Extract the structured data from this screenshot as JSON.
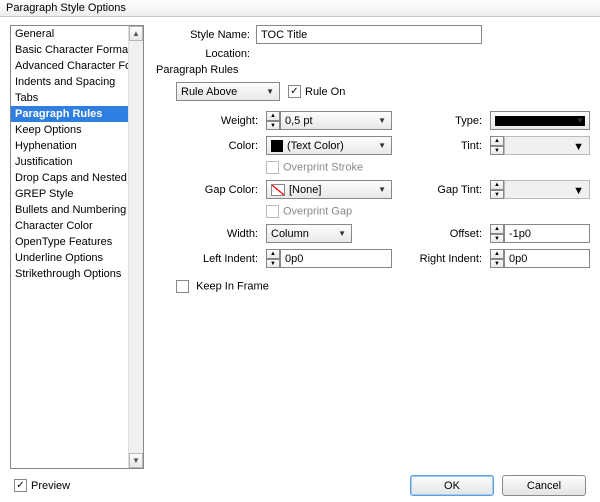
{
  "window": {
    "title": "Paragraph Style Options"
  },
  "sidebar": {
    "items": [
      {
        "label": "General"
      },
      {
        "label": "Basic Character Formats"
      },
      {
        "label": "Advanced Character Formats"
      },
      {
        "label": "Indents and Spacing"
      },
      {
        "label": "Tabs"
      },
      {
        "label": "Paragraph Rules"
      },
      {
        "label": "Keep Options"
      },
      {
        "label": "Hyphenation"
      },
      {
        "label": "Justification"
      },
      {
        "label": "Drop Caps and Nested Styles"
      },
      {
        "label": "GREP Style"
      },
      {
        "label": "Bullets and Numbering"
      },
      {
        "label": "Character Color"
      },
      {
        "label": "OpenType Features"
      },
      {
        "label": "Underline Options"
      },
      {
        "label": "Strikethrough Options"
      }
    ],
    "selected_index": 5
  },
  "header": {
    "style_name_label": "Style Name:",
    "style_name_value": "TOC Title",
    "location_label": "Location:",
    "section_title": "Paragraph Rules"
  },
  "rule": {
    "dropdown_label": "Rule Above",
    "on_label": "Rule On",
    "on_checked": true,
    "weight_label": "Weight:",
    "weight_value": "0,5 pt",
    "type_label": "Type:",
    "color_label": "Color:",
    "color_value": "(Text Color)",
    "overprint_stroke_label": "Overprint Stroke",
    "tint_label": "Tint:",
    "tint_value": "",
    "gap_color_label": "Gap Color:",
    "gap_color_value": "[None]",
    "overprint_gap_label": "Overprint Gap",
    "gap_tint_label": "Gap Tint:",
    "gap_tint_value": "",
    "width_label": "Width:",
    "width_value": "Column",
    "offset_label": "Offset:",
    "offset_value": "-1p0",
    "left_indent_label": "Left Indent:",
    "left_indent_value": "0p0",
    "right_indent_label": "Right Indent:",
    "right_indent_value": "0p0",
    "keep_in_frame_label": "Keep In Frame"
  },
  "footer": {
    "preview_label": "Preview",
    "preview_checked": true,
    "ok_label": "OK",
    "cancel_label": "Cancel"
  }
}
